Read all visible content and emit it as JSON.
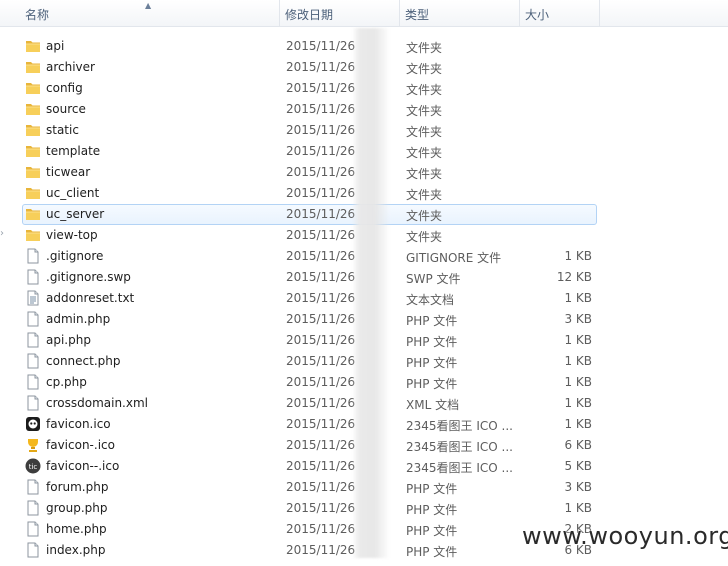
{
  "columns": {
    "name": "名称",
    "date": "修改日期",
    "type": "类型",
    "size": "大小"
  },
  "tree_arrow": "›",
  "watermark": "www.wooyun.org",
  "files": [
    {
      "name": "api",
      "date": "2015/11/26",
      "type": "文件夹",
      "size": "",
      "icon": "folder-icon"
    },
    {
      "name": "archiver",
      "date": "2015/11/26",
      "type": "文件夹",
      "size": "",
      "icon": "folder-icon"
    },
    {
      "name": "config",
      "date": "2015/11/26",
      "type": "文件夹",
      "size": "",
      "icon": "folder-icon"
    },
    {
      "name": "source",
      "date": "2015/11/26",
      "type": "文件夹",
      "size": "",
      "icon": "folder-icon"
    },
    {
      "name": "static",
      "date": "2015/11/26",
      "type": "文件夹",
      "size": "",
      "icon": "folder-icon"
    },
    {
      "name": "template",
      "date": "2015/11/26",
      "type": "文件夹",
      "size": "",
      "icon": "folder-icon"
    },
    {
      "name": "ticwear",
      "date": "2015/11/26",
      "type": "文件夹",
      "size": "",
      "icon": "folder-icon"
    },
    {
      "name": "uc_client",
      "date": "2015/11/26",
      "type": "文件夹",
      "size": "",
      "icon": "folder-icon"
    },
    {
      "name": "uc_server",
      "date": "2015/11/26",
      "type": "文件夹",
      "size": "",
      "icon": "folder-icon",
      "selected": true
    },
    {
      "name": "view-top",
      "date": "2015/11/26",
      "type": "文件夹",
      "size": "",
      "icon": "folder-icon"
    },
    {
      "name": ".gitignore",
      "date": "2015/11/26",
      "type": "GITIGNORE 文件",
      "size": "1 KB",
      "icon": "file-icon"
    },
    {
      "name": ".gitignore.swp",
      "date": "2015/11/26",
      "type": "SWP 文件",
      "size": "12 KB",
      "icon": "file-icon"
    },
    {
      "name": "addonreset.txt",
      "date": "2015/11/26",
      "type": "文本文档",
      "size": "1 KB",
      "icon": "text-file-icon"
    },
    {
      "name": "admin.php",
      "date": "2015/11/26",
      "type": "PHP 文件",
      "size": "3 KB",
      "icon": "file-icon"
    },
    {
      "name": "api.php",
      "date": "2015/11/26",
      "type": "PHP 文件",
      "size": "1 KB",
      "icon": "file-icon"
    },
    {
      "name": "connect.php",
      "date": "2015/11/26",
      "type": "PHP 文件",
      "size": "1 KB",
      "icon": "file-icon"
    },
    {
      "name": "cp.php",
      "date": "2015/11/26",
      "type": "PHP 文件",
      "size": "1 KB",
      "icon": "file-icon"
    },
    {
      "name": "crossdomain.xml",
      "date": "2015/11/26",
      "type": "XML 文档",
      "size": "1 KB",
      "icon": "file-icon"
    },
    {
      "name": "favicon.ico",
      "date": "2015/11/26",
      "type": "2345看图王 ICO ...",
      "size": "1 KB",
      "icon": "favicon-robot-icon"
    },
    {
      "name": "favicon-.ico",
      "date": "2015/11/26",
      "type": "2345看图王 ICO ...",
      "size": "6 KB",
      "icon": "favicon-trophy-icon"
    },
    {
      "name": "favicon--.ico",
      "date": "2015/11/26",
      "type": "2345看图王 ICO ...",
      "size": "5 KB",
      "icon": "favicon-tic-icon"
    },
    {
      "name": "forum.php",
      "date": "2015/11/26",
      "type": "PHP 文件",
      "size": "3 KB",
      "icon": "file-icon"
    },
    {
      "name": "group.php",
      "date": "2015/11/26",
      "type": "PHP 文件",
      "size": "1 KB",
      "icon": "file-icon"
    },
    {
      "name": "home.php",
      "date": "2015/11/26",
      "type": "PHP 文件",
      "size": "2 KB",
      "icon": "file-icon"
    },
    {
      "name": "index.php",
      "date": "2015/11/26",
      "type": "PHP 文件",
      "size": "6 KB",
      "icon": "file-icon"
    }
  ]
}
